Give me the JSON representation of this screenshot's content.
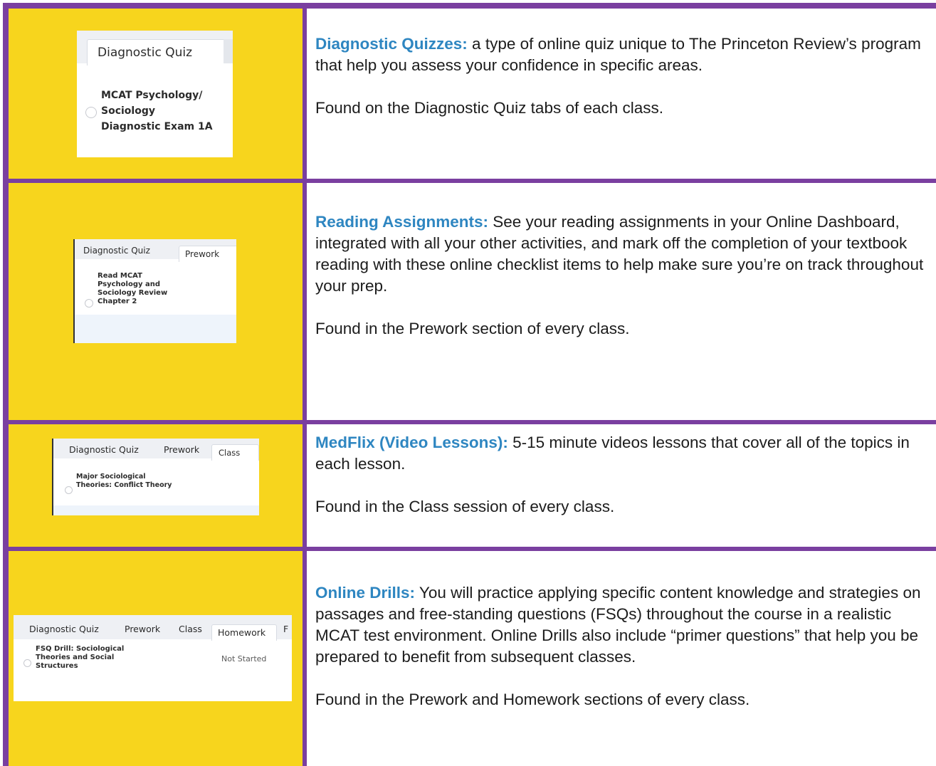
{
  "rows": [
    {
      "thumbnail": {
        "tabs": [
          "Diagnostic Quiz"
        ],
        "active_tab": "Diagnostic Quiz",
        "item_lines": [
          "MCAT Psychology/",
          "Sociology",
          "Diagnostic Exam 1A"
        ]
      },
      "term": "Diagnostic Quizzes:",
      "description": " a type of online quiz unique to The Princeton Review’s program that help you assess your confidence in specific areas.",
      "found": "Found on the Diagnostic Quiz tabs of each class."
    },
    {
      "thumbnail": {
        "tabs": [
          "Diagnostic Quiz",
          "Prework"
        ],
        "active_tab": "Prework",
        "item_lines": [
          "Read MCAT",
          "Psychology and",
          "Sociology Review",
          "Chapter 2"
        ]
      },
      "term": "Reading Assignments:",
      "description": " See your reading assignments in your Online Dashboard, integrated with all your other activities, and mark off the completion of your textbook reading with these online checklist items to help make sure you’re on track throughout your prep.",
      "found": "Found in the Prework section of every class."
    },
    {
      "thumbnail": {
        "tabs": [
          "Diagnostic Quiz",
          "Prework",
          "Class"
        ],
        "active_tab": "Class",
        "item_lines": [
          "Major Sociological",
          "Theories: Conflict Theory"
        ]
      },
      "term": "MedFlix (Video Lessons):",
      "description": " 5-15 minute videos lessons that cover all of the topics in each lesson.",
      "found": "Found in the Class session of every class."
    },
    {
      "thumbnail": {
        "tabs": [
          "Diagnostic Quiz",
          "Prework",
          "Class",
          "Homework",
          "F"
        ],
        "active_tab": "Homework",
        "item_lines": [
          "FSQ Drill: Sociological",
          "Theories and Social",
          "Structures"
        ],
        "status": "Not Started"
      },
      "term": "Online Drills:",
      "description": " You will practice applying specific content knowledge and strategies on passages and free-standing questions (FSQs) throughout the course in a realistic MCAT test environment. Online Drills also include “primer questions” that help you be prepared to benefit from subsequent classes.",
      "found": "Found in the Prework and Homework sections of every class."
    }
  ],
  "colors": {
    "border": "#7a3fa0",
    "left_fill": "#f7d51d",
    "term": "#2e86c1",
    "text": "#1c1c1c"
  }
}
